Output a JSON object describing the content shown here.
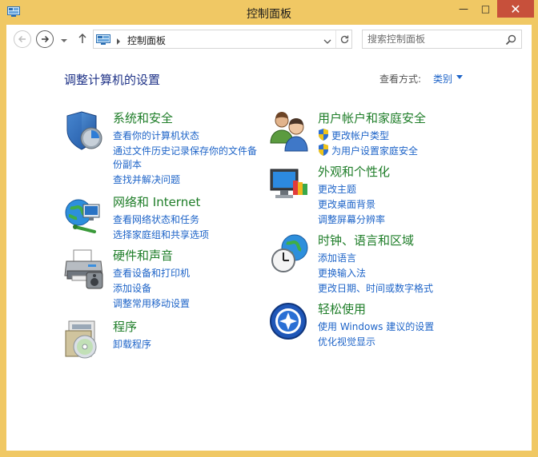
{
  "window": {
    "title": "控制面板"
  },
  "titlebar_buttons": {
    "minimize": "—",
    "maximize": "□",
    "close": "✕"
  },
  "nav": {
    "address_text": "控制面板",
    "search_placeholder": "搜索控制面板"
  },
  "main": {
    "heading": "调整计算机的设置",
    "view_by_label": "查看方式:",
    "view_by_value": "类别"
  },
  "categories": [
    {
      "id": "system-security",
      "title": "系统和安全",
      "icon": "shield-icon",
      "links": [
        "查看你的计算机状态",
        "通过文件历史记录保存你的文件备",
        "份副本",
        "查找并解决问题"
      ]
    },
    {
      "id": "network-internet",
      "title": "网络和 Internet",
      "icon": "network-globe-icon",
      "links": [
        "查看网络状态和任务",
        "选择家庭组和共享选项"
      ]
    },
    {
      "id": "hardware-sound",
      "title": "硬件和声音",
      "icon": "printer-icon",
      "links": [
        "查看设备和打印机",
        "添加设备",
        "调整常用移动设置"
      ]
    },
    {
      "id": "programs",
      "title": "程序",
      "icon": "programs-disc-icon",
      "links": [
        "卸载程序"
      ]
    },
    {
      "id": "user-accounts",
      "title": "用户帐户和家庭安全",
      "icon": "users-icon",
      "links": [
        "更改帐户类型",
        "为用户设置家庭安全"
      ]
    },
    {
      "id": "appearance",
      "title": "外观和个性化",
      "icon": "monitor-palette-icon",
      "links": [
        "更改主题",
        "更改桌面背景",
        "调整屏幕分辨率"
      ]
    },
    {
      "id": "clock-region",
      "title": "时钟、语言和区域",
      "icon": "clock-globe-icon",
      "links": [
        "添加语言",
        "更换输入法",
        "更改日期、时间或数字格式"
      ]
    },
    {
      "id": "ease-of-access",
      "title": "轻松使用",
      "icon": "ease-of-access-icon",
      "links": [
        "使用 Windows 建议的设置",
        "优化视觉显示"
      ]
    }
  ],
  "colors": {
    "frame": "#f0c864",
    "heading": "#1e3287",
    "category_title": "#1e7d28",
    "link": "#1e64c8",
    "close_button": "#c7503b"
  }
}
